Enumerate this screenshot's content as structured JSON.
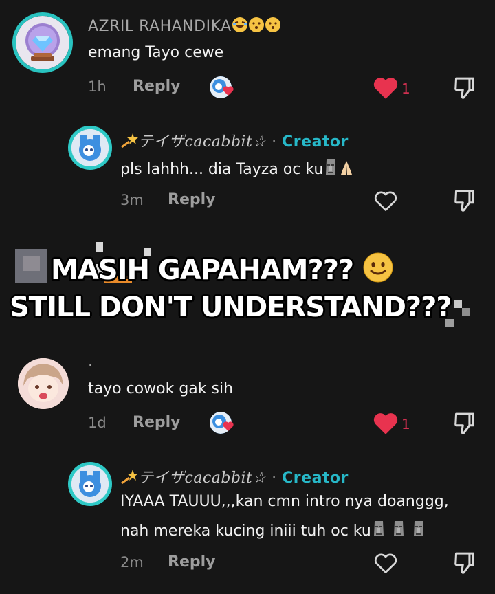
{
  "comments": [
    {
      "username": "AZRIL RAHANDIKA",
      "text": "emang Tayo cewe",
      "time": "1h",
      "reply_label": "Reply",
      "like_count": "1"
    },
    {
      "username": "テイザcacabbit☆",
      "badge_sep": "·",
      "badge": "Creator",
      "text": "pls lahhh... dia Tayza oc ku",
      "time": "3m",
      "reply_label": "Reply"
    },
    {
      "username": "·",
      "text": "tayo cowok gak sih",
      "time": "1d",
      "reply_label": "Reply",
      "like_count": "1"
    },
    {
      "username": "テイザcacabbit☆",
      "badge_sep": "·",
      "badge": "Creator",
      "text_line1": "IYAAA TAUUU,,,kan cmn intro nya doanggg,",
      "text_line2": "nah mereka kucing iniii tuh oc ku",
      "time": "2m",
      "reply_label": "Reply"
    }
  ],
  "overlay": {
    "line1": "MASIH GAPAHAM???",
    "line2": "STILL DON'T UNDERSTAND???"
  },
  "colors": {
    "background": "#161616",
    "creator": "#27b8c8",
    "like_red": "#e8334f",
    "ring": "#2ec9c6"
  },
  "icons": [
    "crystal-ball-avatar",
    "heart-icon",
    "dislike-icon",
    "laughing-emoji",
    "kissing-emoji",
    "moai-emoji",
    "praying-hands-emoji",
    "shooting-star-emoji",
    "slightly-smiling-emoji"
  ]
}
